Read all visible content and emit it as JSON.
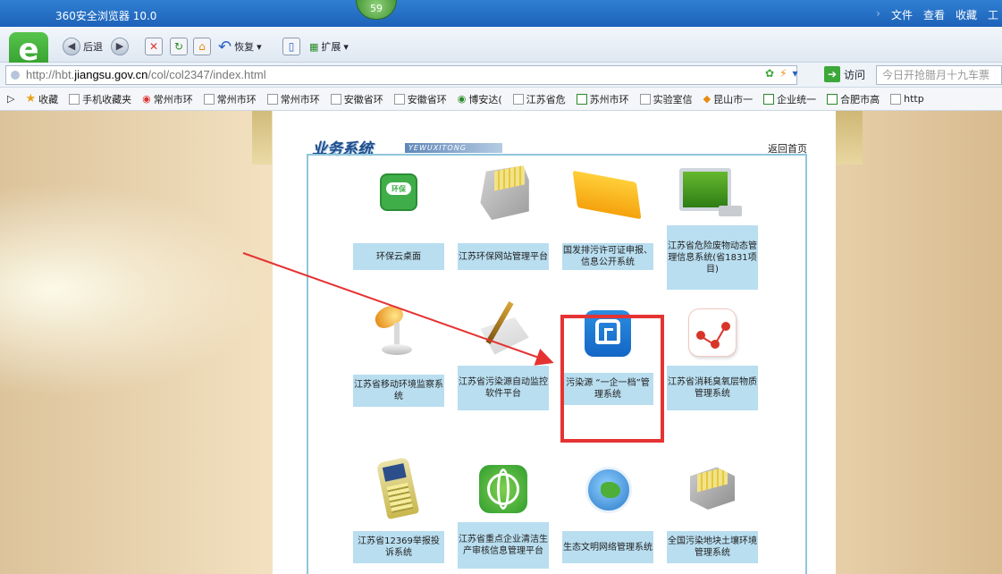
{
  "window": {
    "title": "360安全浏览器 10.0",
    "tab_count": "59"
  },
  "menu": [
    "文件",
    "查看",
    "收藏",
    "工"
  ],
  "toolbar": {
    "back_label": "后退",
    "restore_label": "恢复",
    "extensions_label": "扩展"
  },
  "address": {
    "prefix": "http://hbt.",
    "domain": "jiangsu.gov.cn",
    "path": "/col/col2347/index.html",
    "go_label": "访问",
    "search_placeholder": "今日开抢腊月十九车票"
  },
  "bookmarks": [
    "收藏",
    "手机收藏夹",
    "常州市环",
    "常州市环",
    "常州市环",
    "安徽省环",
    "安徽省环",
    "博安达(",
    "江苏省危",
    "苏州市环",
    "实验室信",
    "昆山市一",
    "企业统一",
    "合肥市高",
    "http"
  ],
  "panel": {
    "title": "业务系统",
    "title_en": "YEWUXITONG",
    "home_link": "返回首页"
  },
  "tiles": [
    {
      "label": "环保云桌面",
      "icon": "cloud-icon",
      "cloud_text": "环保"
    },
    {
      "label": "江苏环保网站管理平台",
      "icon": "file-cabinet-icon"
    },
    {
      "label": "国发排污许可证申报、信息公开系统",
      "icon": "book-icon"
    },
    {
      "label": "江苏省危险废物动态管理信息系统(省1831项目)",
      "icon": "monitor-icon"
    },
    {
      "label": "江苏省移动环境监察系统",
      "icon": "lamp-icon"
    },
    {
      "label": "江苏省污染源自动监控软件平台",
      "icon": "pen-notebook-icon"
    },
    {
      "label": "污染源 “一企一档”管理系统",
      "icon": "house-icon"
    },
    {
      "label": "江苏省消耗臭氧层物质管理系统",
      "icon": "molecule-icon"
    },
    {
      "label": "江苏省12369举报投诉系统",
      "icon": "handset-icon"
    },
    {
      "label": "江苏省重点企业清洁生产审核信息管理平台",
      "icon": "atom-icon"
    },
    {
      "label": "生态文明网络管理系统",
      "icon": "globe-icon"
    },
    {
      "label": "全国污染地块土壤环境管理系统",
      "icon": "file-cabinet-icon"
    }
  ],
  "colors": {
    "highlight": "#e53333",
    "accent": "#1e4e8c",
    "label_bg": "#b9def0"
  }
}
